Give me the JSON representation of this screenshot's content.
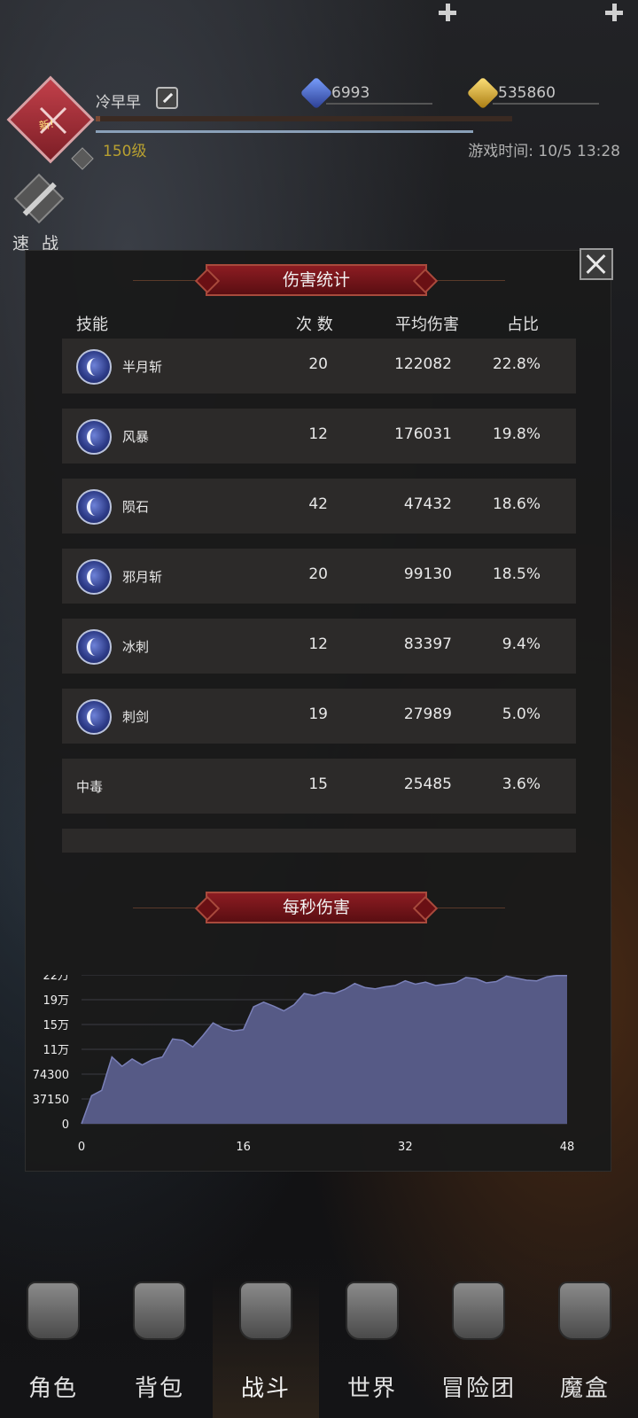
{
  "header": {
    "avatar_badge": "新!",
    "player_name": "冷早早",
    "level": "150级",
    "xp_fraction": 0.01,
    "hp_fraction": 1.0,
    "game_time": "游戏时间: 10/5 13:28",
    "blue_gem_count": "6993",
    "gold_gem_count": "535860",
    "quick_battle_label": "速 战"
  },
  "modal": {
    "title": "伤害统计",
    "columns": {
      "skill": "技能",
      "count": "次 数",
      "avg": "平均伤害",
      "pct": "占比"
    },
    "rows": [
      {
        "name": "半月斩",
        "count": "20",
        "avg": "122082",
        "pct": "22.8%",
        "icon": "crescent-moon-icon"
      },
      {
        "name": "风暴",
        "count": "12",
        "avg": "176031",
        "pct": "19.8%",
        "icon": "storm-icon"
      },
      {
        "name": "陨石",
        "count": "42",
        "avg": "47432",
        "pct": "18.6%",
        "icon": "meteor-icon"
      },
      {
        "name": "邪月斩",
        "count": "20",
        "avg": "99130",
        "pct": "18.5%",
        "icon": "evil-moon-slash-icon"
      },
      {
        "name": "冰刺",
        "count": "12",
        "avg": "83397",
        "pct": "9.4%",
        "icon": "ice-spike-icon"
      },
      {
        "name": "刺剑",
        "count": "19",
        "avg": "27989",
        "pct": "5.0%",
        "icon": "rapier-icon"
      },
      {
        "name": "中毒",
        "count": "15",
        "avg": "25485",
        "pct": "3.6%",
        "icon": ""
      }
    ],
    "dps_title": "每秒伤害"
  },
  "chart_data": {
    "type": "area",
    "title": "每秒伤害",
    "xlabel": "",
    "ylabel": "",
    "x_ticks": [
      "0",
      "16",
      "32",
      "48"
    ],
    "y_ticks": [
      "0",
      "37150",
      "74300",
      "11万",
      "15万",
      "19万",
      "22万"
    ],
    "xlim": [
      0,
      48
    ],
    "ylim": [
      0,
      222900
    ],
    "grid": true,
    "color": "#565a86",
    "x": [
      0,
      1,
      2,
      3,
      4,
      5,
      6,
      7,
      8,
      9,
      10,
      11,
      12,
      13,
      14,
      15,
      16,
      17,
      18,
      19,
      20,
      21,
      22,
      23,
      24,
      25,
      26,
      27,
      28,
      29,
      30,
      31,
      32,
      33,
      34,
      35,
      36,
      37,
      38,
      39,
      40,
      41,
      42,
      43,
      44,
      45,
      46,
      47,
      48
    ],
    "y": [
      0,
      42000,
      50000,
      100000,
      86000,
      97000,
      88000,
      96000,
      100000,
      127000,
      125000,
      115000,
      132000,
      151000,
      143000,
      139000,
      141000,
      175000,
      182000,
      176000,
      169000,
      178000,
      195000,
      192000,
      197000,
      195000,
      201000,
      210000,
      204000,
      202000,
      205000,
      207000,
      214000,
      209000,
      212000,
      207000,
      209000,
      211000,
      219000,
      217000,
      211000,
      213000,
      221000,
      218000,
      215000,
      214000,
      220000,
      222000,
      222000
    ]
  },
  "nav": [
    {
      "label": "角色",
      "icon": "helmet-icon",
      "active": false
    },
    {
      "label": "背包",
      "icon": "backpack-icon",
      "active": false
    },
    {
      "label": "战斗",
      "icon": "shield-sword-icon",
      "active": true
    },
    {
      "label": "世界",
      "icon": "world-map-icon",
      "active": false
    },
    {
      "label": "冒险团",
      "icon": "castle-icon",
      "active": false
    },
    {
      "label": "魔盒",
      "icon": "magic-cube-icon",
      "active": false
    }
  ],
  "colors": {
    "banner": "#8c1c22",
    "level_text": "#b8a030",
    "blue_gem": "#3a5ab0",
    "gold_gem": "#d8b030",
    "chart_fill": "#565a86"
  }
}
